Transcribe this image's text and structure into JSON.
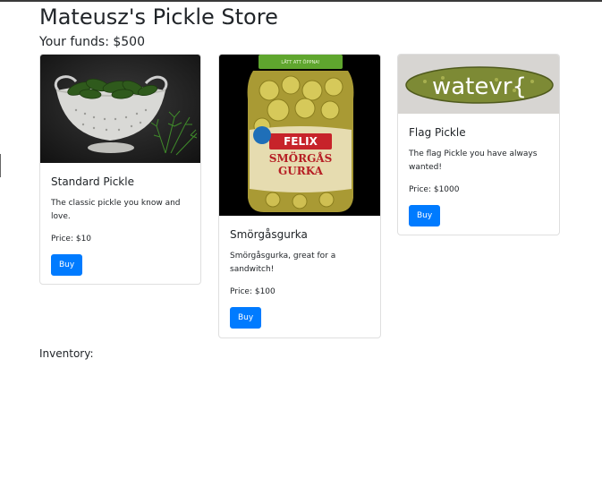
{
  "store": {
    "title": "Mateusz's Pickle Store",
    "funds_label": "Your funds: $500"
  },
  "products": [
    {
      "name": "Standard Pickle",
      "description": "The classic pickle you know and love.",
      "price": "Price: $10",
      "button": "Buy",
      "image_icon": "colander-pickles-image"
    },
    {
      "name": "Smörgåsgurka",
      "description": "Smörgåsgurka, great for a sandwitch!",
      "price": "Price: $100",
      "button": "Buy",
      "image_icon": "pickle-jar-image",
      "jar_brand": "FELIX",
      "jar_label_line1": "SMÖRGÅS",
      "jar_label_line2": "GURKA",
      "jar_lid_text": "LÄTT ATT ÖPPNA!"
    },
    {
      "name": "Flag Pickle",
      "description": "The flag Pickle you have always wanted!",
      "price": "Price: $1000",
      "button": "Buy",
      "image_icon": "flag-pickle-image",
      "image_overlay_text": "watevr{"
    }
  ],
  "inventory": {
    "label": "Inventory:"
  },
  "colors": {
    "primary_button": "#007bff",
    "card_border": "#dfdfdf",
    "text": "#212529"
  }
}
